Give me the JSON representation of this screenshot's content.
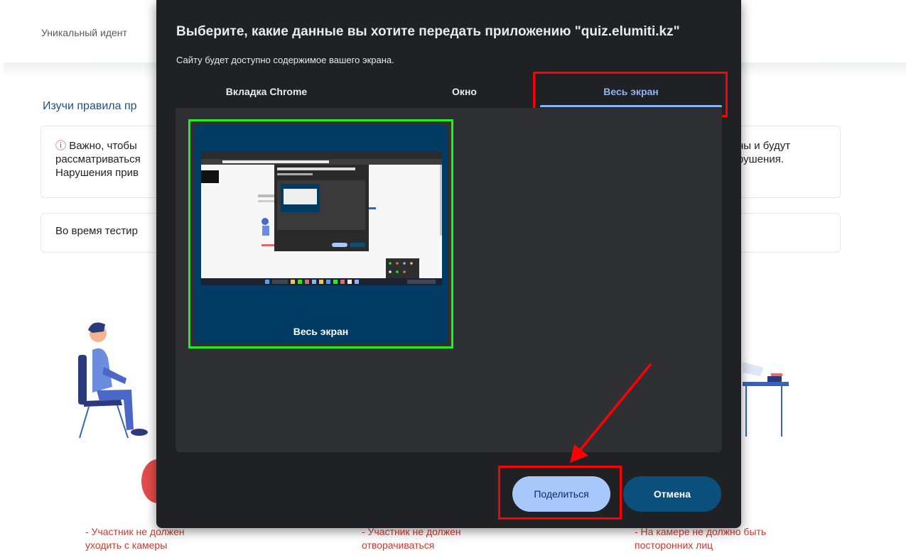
{
  "background": {
    "header_id_text": "Уникальный идент",
    "rules_title": "Изучи правила пр",
    "notice_left": "Важно, чтобы\nрассматриваться\nНарушения прив",
    "notice_alert_icon": "alert-circle-icon",
    "notice_right": "ны и будут\nрушения.",
    "during_test_text": "Во время тестир",
    "rules": [
      "- Участник не должен\nуходить с камеры",
      "- Участник не должен\nотворачиваться",
      "- На камере не должно быть\nпосторонних лиц"
    ],
    "rule_color": "#d9342b"
  },
  "dialog": {
    "title": "Выберите, какие данные вы хотите передать приложению \"quiz.elumiti.kz\"",
    "subtitle": "Сайту будет доступно содержимое вашего экрана.",
    "tabs": [
      {
        "label": "Вкладка Chrome",
        "selected": false
      },
      {
        "label": "Окно",
        "selected": false
      },
      {
        "label": "Весь экран",
        "selected": true
      }
    ],
    "source": {
      "label": "Весь экран",
      "selected": true
    },
    "share_label": "Поделиться",
    "cancel_label": "Отмена",
    "accent_color": "#8ab4f8",
    "highlight_color": "#ff0000",
    "selection_color": "#1df21d"
  }
}
